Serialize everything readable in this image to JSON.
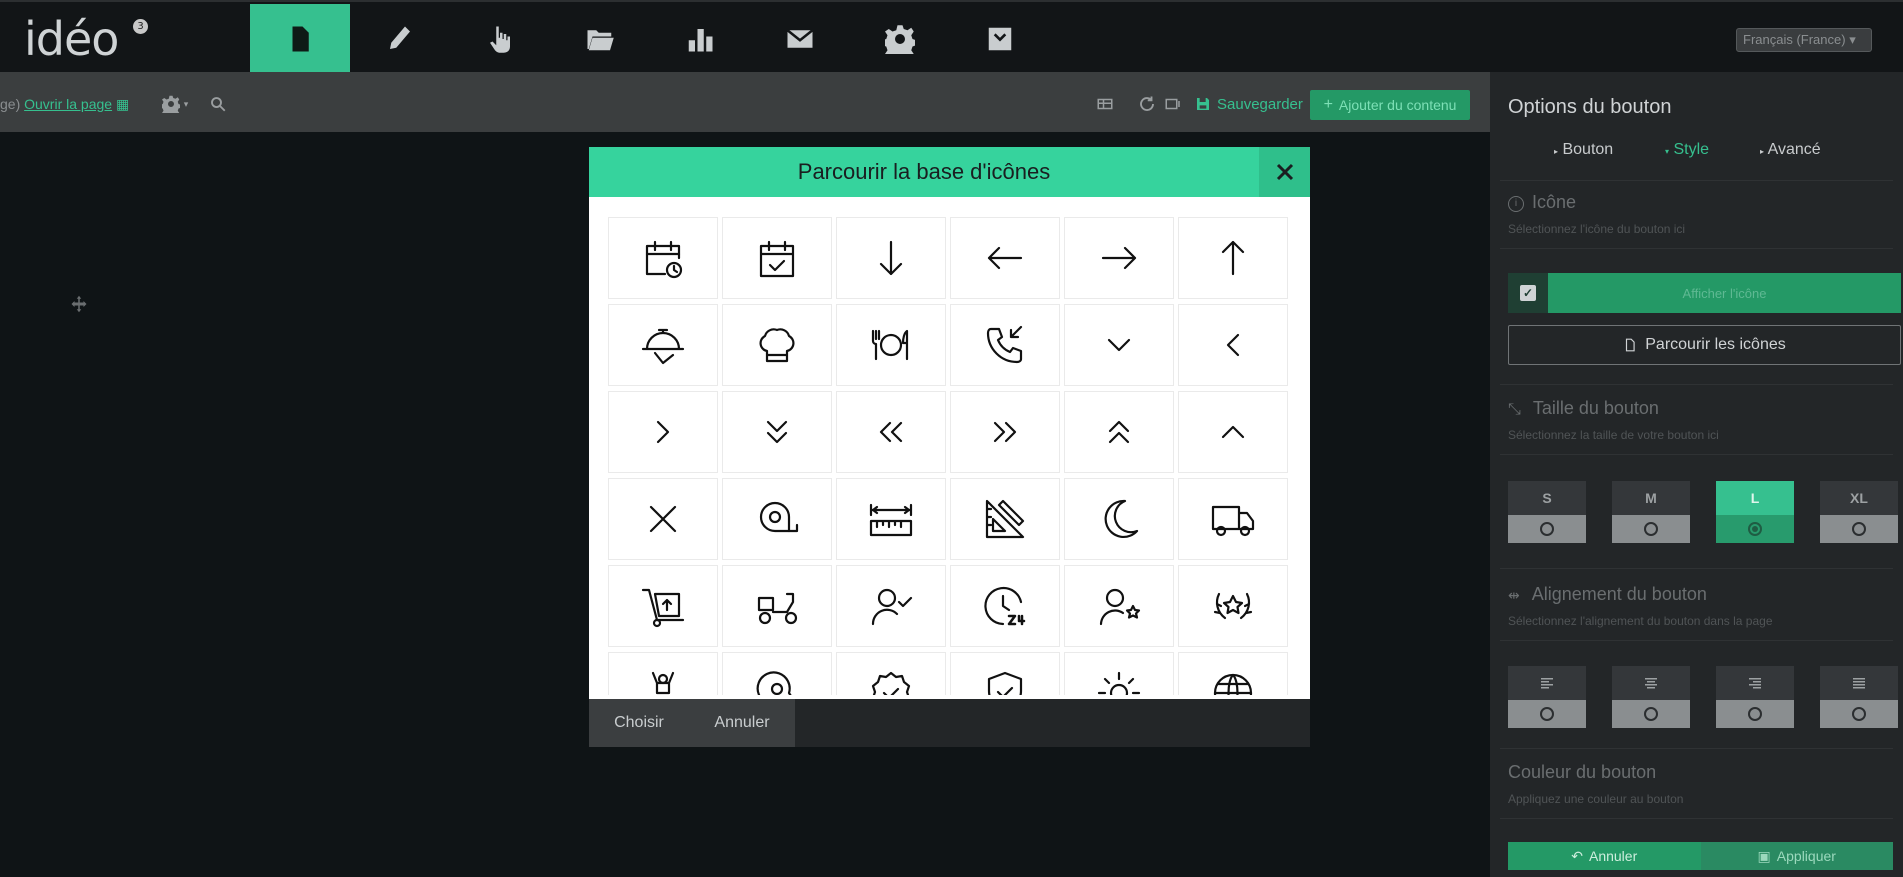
{
  "app": {
    "logo": "idéo",
    "logo_badge": "3"
  },
  "nav": {
    "items": [
      {
        "icon": "file-icon"
      },
      {
        "icon": "pencil-icon"
      },
      {
        "icon": "pointer-hand-icon"
      },
      {
        "icon": "folder-icon"
      },
      {
        "icon": "bar-chart-icon"
      },
      {
        "icon": "envelope-icon"
      },
      {
        "icon": "gear-icon"
      },
      {
        "icon": "chevron-square-down-icon"
      }
    ],
    "language": "Français (France) ▾"
  },
  "toolbar": {
    "open_prefix": "ge)",
    "open_page": "Ouvrir la page",
    "save_label": "Sauvegarder",
    "add_content_label": "Ajouter du contenu"
  },
  "panel": {
    "title": "Options du bouton",
    "tabs": [
      "Bouton",
      "Style",
      "Avancé"
    ],
    "active_tab": "Style",
    "icon_section": {
      "title": "Icône",
      "subtitle": "Sélectionnez l'icône du bouton ici"
    },
    "show_icon_label": "Afficher l'icône",
    "browse_icons_label": "Parcourir les icônes",
    "size_section": {
      "title": "Taille du bouton",
      "subtitle": "Sélectionnez la taille de votre bouton ici"
    },
    "sizes": [
      "S",
      "M",
      "L",
      "XL"
    ],
    "selected_size": "L",
    "align_section": {
      "title": "Alignement du bouton",
      "subtitle": "Sélectionnez l'alignement du bouton dans la page"
    },
    "alignments": [
      "left",
      "center",
      "right",
      "justify"
    ],
    "color_section": {
      "title": "Couleur du bouton",
      "subtitle": "Appliquez une couleur au bouton"
    },
    "cancel_label": "Annuler",
    "apply_label": "Appliquer"
  },
  "modal": {
    "title": "Parcourir la base d'icônes",
    "choose_label": "Choisir",
    "cancel_label": "Annuler",
    "icons": [
      "calendar-clock-icon",
      "calendar-check-icon",
      "arrow-down-icon",
      "arrow-left-icon",
      "arrow-right-icon",
      "arrow-up-icon",
      "cloche-serving-icon",
      "chef-hat-icon",
      "plate-cutlery-icon",
      "phone-incoming-icon",
      "chevron-down-icon",
      "chevron-left-icon",
      "chevron-right-icon",
      "chevrons-down-icon",
      "chevrons-left-icon",
      "chevrons-right-icon",
      "chevrons-up-icon",
      "chevron-up-icon",
      "close-icon",
      "tape-measure-icon",
      "ruler-width-icon",
      "ruler-square-icon",
      "moon-icon",
      "delivery-truck-icon",
      "hand-truck-icon",
      "delivery-scooter-icon",
      "user-check-icon",
      "clock-24-icon",
      "user-star-icon",
      "laurel-star-icon",
      "podium-winner-icon",
      "head-gear-icon",
      "badge-check-icon",
      "shield-check-icon",
      "sun-icon",
      "globe-icon"
    ]
  },
  "colors": {
    "accent": "#36c08f",
    "modal_header": "#36d39d",
    "background": "#0f1416"
  }
}
